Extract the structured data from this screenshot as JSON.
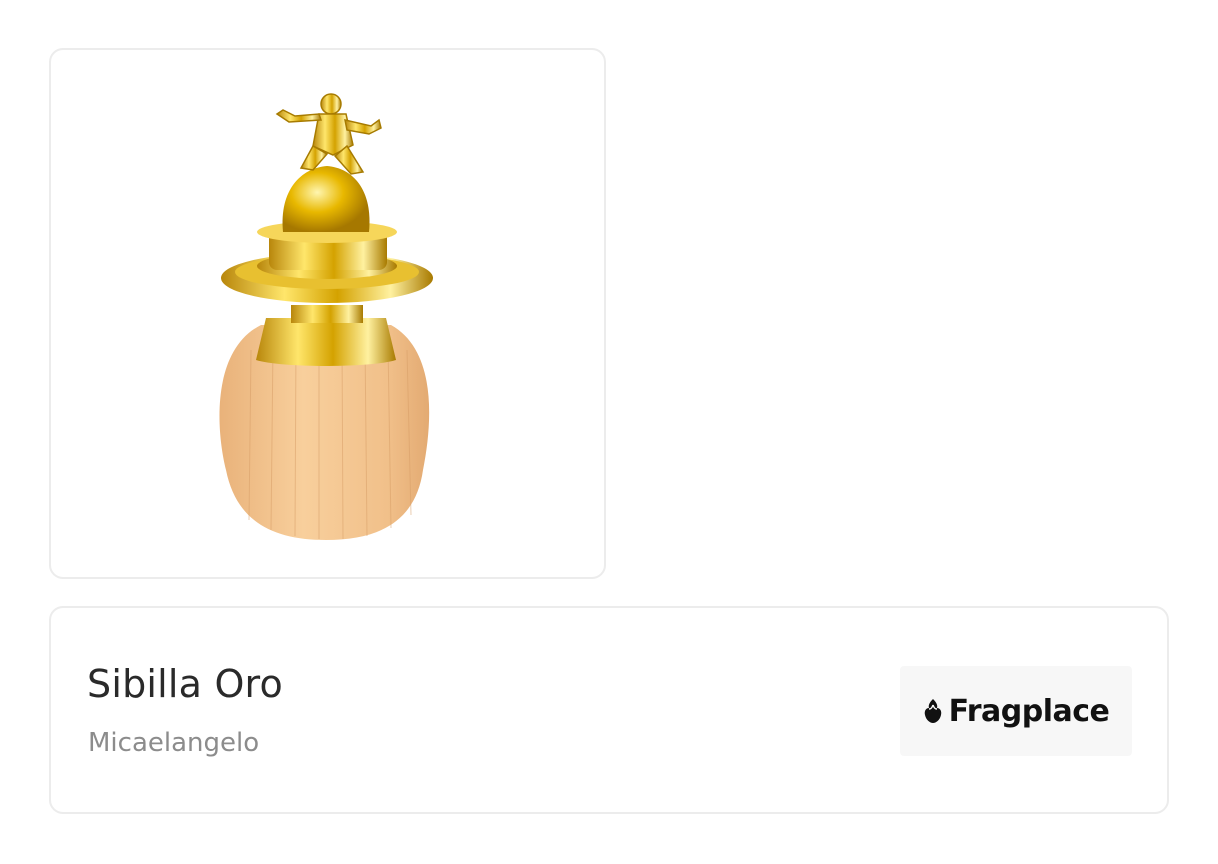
{
  "product": {
    "image_icon": "perfume-bottle-image",
    "title": "Sibilla Oro",
    "brand": "Micaelangelo"
  },
  "store": {
    "icon": "rose-icon",
    "name": "Fragplace"
  }
}
